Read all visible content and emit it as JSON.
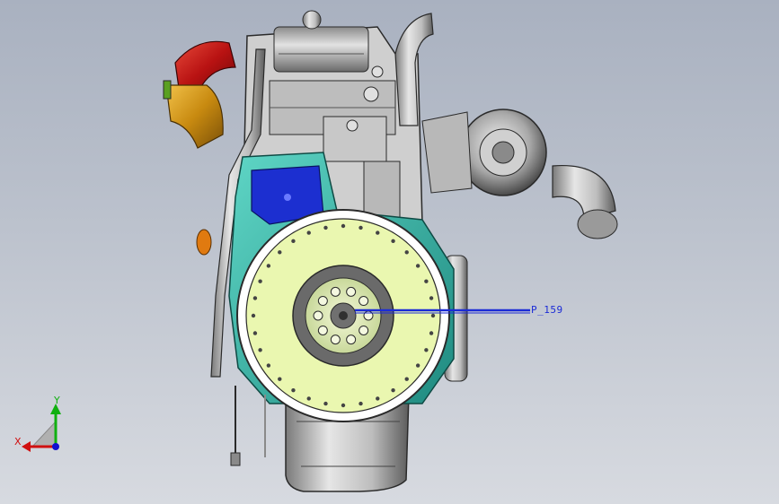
{
  "viewport": {
    "background_top": "#a9b1c0",
    "background_bottom": "#d7dae0"
  },
  "model": {
    "subject": "engine-assembly",
    "colors": {
      "flywheel_face": "#eaf7b0",
      "flywheel_housing": "#3ab8a8",
      "cover_plate": "#1c2fd0",
      "intake_pipe": "#c01818",
      "elbow_pipe": "#d8a020",
      "metal_light": "#d8d8d8",
      "metal_dark": "#5a5a5a",
      "annotation": "#1b2bd6"
    }
  },
  "annotation": {
    "label": "P_159"
  },
  "triad": {
    "x_label": "X",
    "y_label": "Y",
    "x_color": "#d01010",
    "y_color": "#10b010",
    "z_color": "#1010d0"
  }
}
